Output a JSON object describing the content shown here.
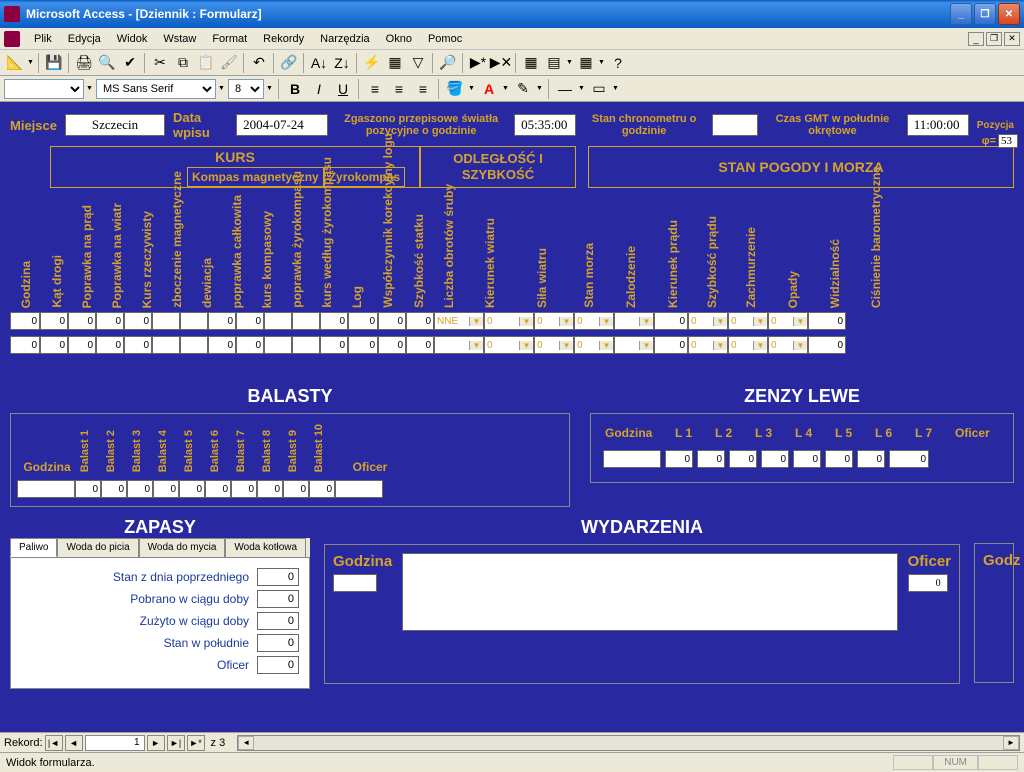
{
  "title": "Microsoft Access - [Dziennik : Formularz]",
  "menu": [
    "Plik",
    "Edycja",
    "Widok",
    "Wstaw",
    "Format",
    "Rekordy",
    "Narzędzia",
    "Okno",
    "Pomoc"
  ],
  "font": {
    "name": "MS Sans Serif",
    "size": "8"
  },
  "top": {
    "miejsce_label": "Miejsce",
    "miejsce": "Szczecin",
    "data_label": "Data wpisu",
    "data": "2004-07-24",
    "swiatla_label": "Zgaszono przepisowe światła pozycyjne o godzinie",
    "swiatla": "05:35:00",
    "chrono_label": "Stan chronometru o godzinie",
    "chrono": " ",
    "gmt_label": "Czas GMT w południe okrętowe",
    "gmt": "11:00:00",
    "pozycja_label": "Pozycja",
    "phi_label": "φ=",
    "phi": "53"
  },
  "sections": {
    "kurs": "KURS",
    "odl": "ODLEGŁOŚĆ I SZYBKOŚĆ",
    "pogoda": "STAN POGODY I MORZA",
    "kompas_mag": "Kompas magnetyczny",
    "zyro": "Żyrokompas"
  },
  "cols": [
    "Godzina",
    "Kąt drogi",
    "Poprawka na prąd",
    "Poprawka na wiatr",
    "Kurs rzeczywisty",
    "zboczenie magnetyczne",
    "dewiacja",
    "poprawka całkowita",
    "kurs kompasowy",
    "poprawka żyrokompasu",
    "kurs według żyrokompasu",
    "Log",
    "Współczynnik korekcyjny logu",
    "Szybkość statku",
    "Liczba obrotów śruby",
    "Kierunek wiatru",
    "Siła wiatru",
    "Stan morza",
    "Zalodzenie",
    "Kierunek prądu",
    "Szybkość prądu",
    "Zachmurzenie",
    "Opady",
    "Widzialność",
    "Ciśnienie barometryczne"
  ],
  "row1": [
    "0",
    "0",
    "0",
    "0",
    "0",
    "",
    "",
    "0",
    "0",
    "",
    "",
    "0",
    "0",
    "0",
    "0",
    "NNE",
    "0",
    "0",
    "0",
    "",
    "0",
    "0",
    "0",
    "0",
    "0"
  ],
  "row2": [
    "0",
    "0",
    "0",
    "0",
    "0",
    "",
    "",
    "0",
    "0",
    "",
    "",
    "0",
    "0",
    "0",
    "0",
    "",
    "0",
    "0",
    "0",
    "",
    "0",
    "0",
    "0",
    "0",
    "0"
  ],
  "combo_cols": [
    15,
    16,
    17,
    18,
    19,
    21,
    22,
    23
  ],
  "balasty": {
    "title": "BALASTY",
    "godzina": "Godzina",
    "oficer": "Oficer",
    "cols": [
      "Balast 1",
      "Balast 2",
      "Balast 3",
      "Balast 4",
      "Balast 5",
      "Balast 6",
      "Balast 7",
      "Balast 8",
      "Balast 9",
      "Balast 10"
    ],
    "vals": [
      "",
      "0",
      "0",
      "0",
      "0",
      "0",
      "0",
      "0",
      "0",
      "0",
      "0",
      ""
    ]
  },
  "zenzy": {
    "title": "ZENZY LEWE",
    "godzina": "Godzina",
    "cols": [
      "L 1",
      "L 2",
      "L 3",
      "L 4",
      "L 5",
      "L 6",
      "L 7"
    ],
    "oficer": "Oficer",
    "vals": [
      "",
      "0",
      "0",
      "0",
      "0",
      "0",
      "0",
      "0",
      "0"
    ]
  },
  "zapasy": {
    "title": "ZAPASY",
    "tabs": [
      "Paliwo",
      "Woda do picia",
      "Woda do mycia",
      "Woda kotłowa"
    ],
    "rows": [
      {
        "label": "Stan z dnia poprzedniego",
        "val": "0"
      },
      {
        "label": "Pobrano w ciągu doby",
        "val": "0"
      },
      {
        "label": "Zużyto w ciągu doby",
        "val": "0"
      },
      {
        "label": "Stan w południe",
        "val": "0"
      },
      {
        "label": "Oficer",
        "val": "0"
      }
    ]
  },
  "wydarzenia": {
    "title": "WYDARZENIA",
    "godzina": "Godzina",
    "oficer": "Oficer",
    "oficer_val": "0",
    "godz2": "Godz"
  },
  "recnav": {
    "label": "Rekord:",
    "cur": "1",
    "of": "z 3"
  },
  "status": "Widok formularza.",
  "status_right": "NUM"
}
